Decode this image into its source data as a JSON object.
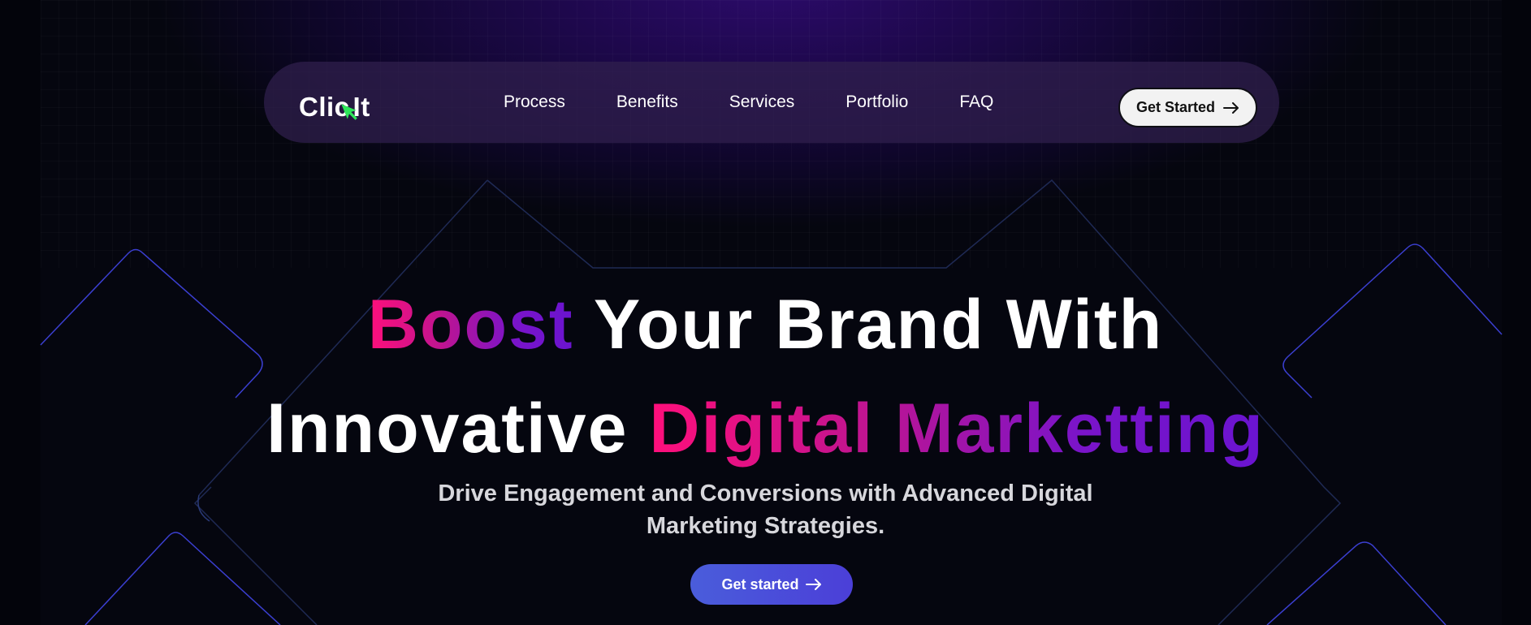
{
  "brand": {
    "logo_text_before": "Clic",
    "logo_text_after": " It"
  },
  "nav": {
    "links": [
      "Process",
      "Benefits",
      "Services",
      "Portfolio",
      "FAQ"
    ],
    "cta_label": "Get Started"
  },
  "hero": {
    "line1_highlight": "Boost",
    "line1_rest": " Your Brand With",
    "line2_start": "Innovative ",
    "line2_highlight": "Digital Marketting",
    "subtext_line1": "Drive Engagement and Conversions with Advanced Digital",
    "subtext_line2": "Marketing Strategies.",
    "cta_label": "Get started"
  },
  "icons": {
    "logo_cursor": "cursor-arrow-icon",
    "cta_arrow": "arrow-right-icon"
  },
  "colors": {
    "accent_pink": "#ff0f7b",
    "accent_purple": "#6a14d0",
    "cursor_green": "#2ee65a",
    "cta_blue": "#4a5ddb",
    "background": "#05060f"
  }
}
